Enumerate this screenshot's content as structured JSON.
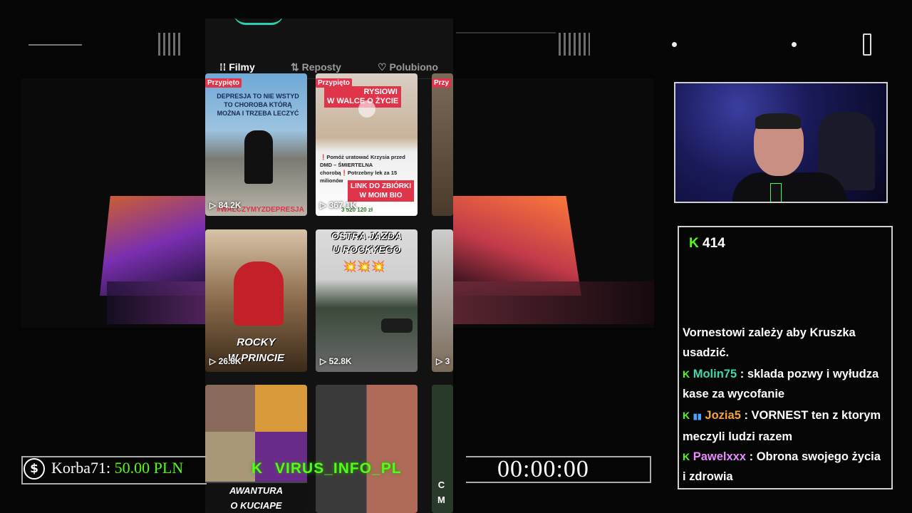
{
  "profile_tabs": {
    "films": "Filmy",
    "reposts": "Reposty",
    "liked": "Polubiono"
  },
  "videos": [
    {
      "pinned": "Przypięto",
      "caption_lines": [
        "DEPRESJA TO NIE WSTYD",
        "TO CHOROBA KTÓRĄ",
        "MOŻNA I TRZEBA LECZYĆ"
      ],
      "hashtag": "#WALCZYMYZDEPRESJA",
      "views": "84.2K"
    },
    {
      "pinned": "Przypięto",
      "title_lines": [
        "RYSIOWI",
        "W WALCE O ŻYCIE"
      ],
      "desc": "❗Pomóż uratować Krzysia przed DMD – ŚMIERTELNA chorobą❗Potrzebny lek za 15 milionów",
      "link_lines": [
        "LINK DO ZBIÓRKI",
        "W MOIM BIO"
      ],
      "amount": "3 520 120 zł",
      "views": "367.1K"
    },
    {
      "pinned": "Przy"
    },
    {
      "caption_lines": [
        "ROCKY",
        "W PRINCIE"
      ],
      "views": "26.8K"
    },
    {
      "title_lines": [
        "OSTRA JAZDA",
        "U ROCKYEGO"
      ],
      "emoji": "💥💥💥",
      "views": "52.8K"
    },
    {
      "views": "3"
    },
    {
      "caption_lines": [
        "AWANTURA",
        "O KUCIAPE"
      ]
    },
    {},
    {
      "caption_lines": [
        "C",
        "M"
      ]
    }
  ],
  "viewer_count": "414",
  "chat": [
    {
      "user": "",
      "text": "Vornestowi zależy aby Kruszka usadzić."
    },
    {
      "user": "Molin75",
      "color": "#3fd9b0",
      "text": " : sklada pozwy i wyłudza kase za wycofanie"
    },
    {
      "user": "Jozia5",
      "color": "#f4a33c",
      "text": " : VORNEST ten z ktorym meczyli ludzi razem"
    },
    {
      "user": "Pawelxxx",
      "color": "#e98bff",
      "text": " : Obrona swojego życia i zdrowia"
    }
  ],
  "donation": {
    "user": "Korba71:",
    "amount": "50.00 PLN"
  },
  "channel_handle": "VIRUS_INFO_PL",
  "timer": "00:00:00",
  "kick_glyph": "K",
  "dollar_glyph": "$",
  "colors": {
    "kick_green": "#53fc18",
    "pin_red": "#e0344a",
    "background": "#050505"
  }
}
